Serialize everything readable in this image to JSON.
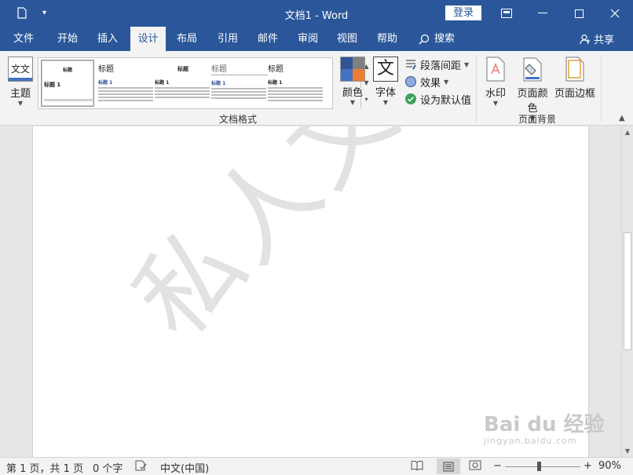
{
  "titlebar": {
    "doc_title": "文档1  -  Word",
    "login": "登录"
  },
  "tabs": [
    {
      "label": "文件"
    },
    {
      "label": "开始"
    },
    {
      "label": "插入"
    },
    {
      "label": "设计"
    },
    {
      "label": "布局"
    },
    {
      "label": "引用"
    },
    {
      "label": "邮件"
    },
    {
      "label": "审阅"
    },
    {
      "label": "视图"
    },
    {
      "label": "帮助"
    }
  ],
  "active_tab": "设计",
  "search": {
    "label": "搜索",
    "icon": "lightbulb-search-icon"
  },
  "share": {
    "label": "共享",
    "icon": "person-icon"
  },
  "ribbon": {
    "theme": {
      "label": "主题",
      "icon_text": "文文"
    },
    "gallery": {
      "items": [
        {
          "heading": "标题",
          "sub": "标题 1"
        },
        {
          "heading": "标题",
          "sub": "标题 1"
        },
        {
          "heading": "标题",
          "sub": "标题 1"
        },
        {
          "heading": "标题",
          "sub": "标题 1"
        },
        {
          "heading": "标题",
          "sub": "标题 1"
        }
      ]
    },
    "colors": {
      "label": "颜色",
      "swatches": [
        "#2f5597",
        "#7f7f7f",
        "#4472c4",
        "#ed7d31"
      ]
    },
    "fonts": {
      "label": "字体",
      "icon_text": "文"
    },
    "paragraph_spacing": "段落间距",
    "effects": "效果",
    "set_default": "设为默认值",
    "group_doc_format": "文档格式",
    "watermark": "水印",
    "page_color": "页面颜色",
    "page_border": "页面边框",
    "group_page_bg": "页面背景"
  },
  "document": {
    "watermark_text": "私人文档"
  },
  "overlay": {
    "brand": "Bai du 经验",
    "url": "jingyan.baidu.com"
  },
  "statusbar": {
    "page": "第 1 页，共 1 页",
    "words": "0 个字",
    "language": "中文(中国)",
    "zoom": "90%",
    "zoom_fraction": 0.45
  },
  "colors": {
    "brand": "#2b579a",
    "ribbon_bg": "#f3f3f3"
  }
}
